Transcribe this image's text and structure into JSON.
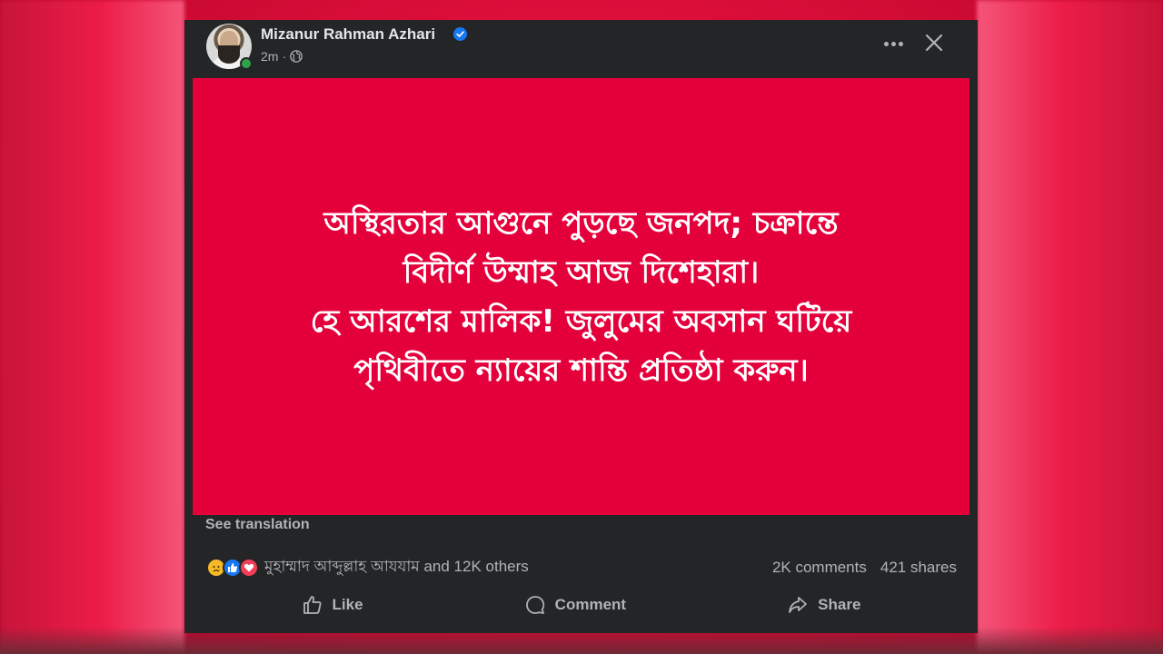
{
  "post": {
    "author": "Mizanur Rahman Azhari",
    "time": "2m",
    "separator": "·",
    "image_text_lines": [
      "অস্থিরতার আগুনে পুড়ছে জনপদ; চক্রান্তে",
      "বিদীর্ণ উম্মাহ আজ দিশেহারা।",
      "হে আরশের মালিক! জুলুমের অবসান ঘটিয়ে",
      "পৃথিবীতে ন্যায়ের শান্তি প্রতিষ্ঠা করুন।"
    ],
    "see_translation": "See translation",
    "reactions_text": "মুহাম্মাদ আব্দুল্লাহ আযযাম and 12K others",
    "comments": "2K comments",
    "shares": "421 shares"
  },
  "actions": {
    "like": "Like",
    "comment": "Comment",
    "share": "Share"
  },
  "icons": {
    "verified": "verified-badge-icon",
    "globe": "globe-icon",
    "more": "more-icon",
    "close": "close-icon",
    "reactions": [
      "sad-reaction-icon",
      "like-reaction-icon",
      "love-reaction-icon"
    ]
  },
  "colors": {
    "post_background": "#242526",
    "image_background": "#e4003b",
    "verified": "#1877f2",
    "online": "#31a24c"
  }
}
